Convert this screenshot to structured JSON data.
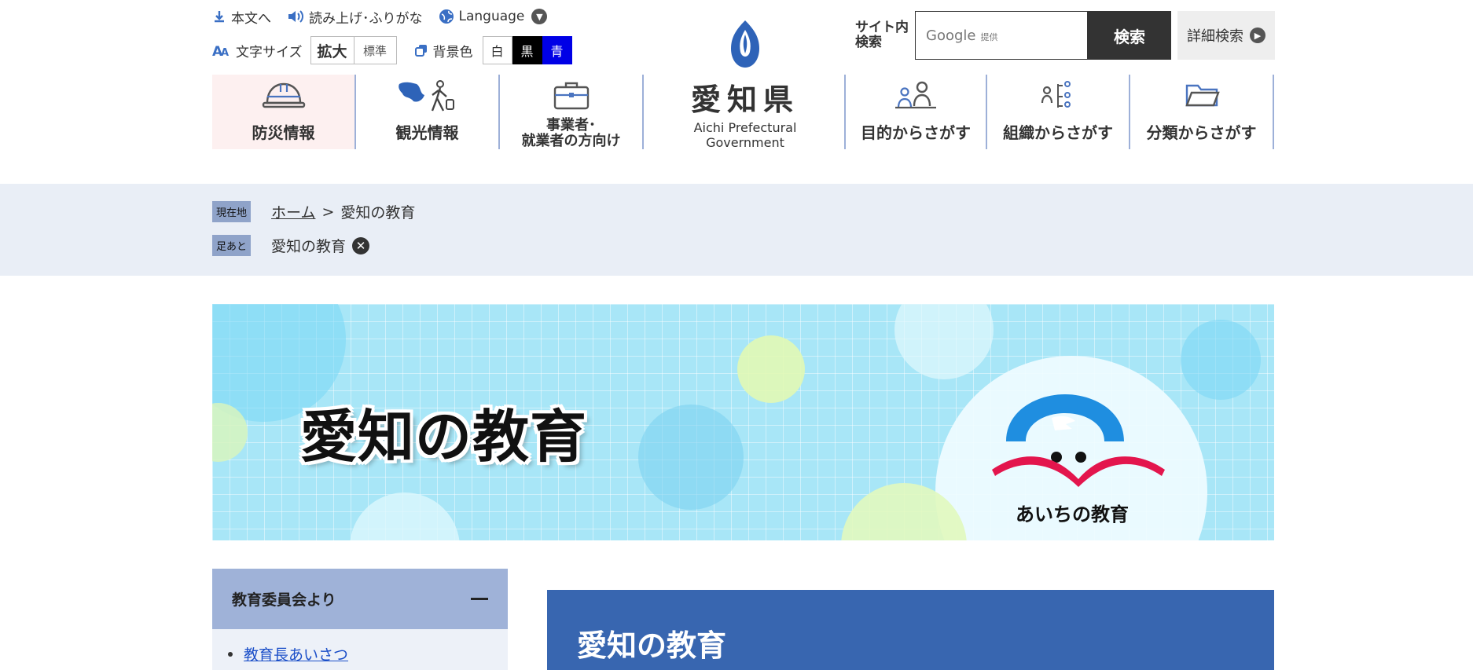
{
  "header": {
    "skip_link": "本文へ",
    "read_aloud": "読み上げ･ふりがな",
    "language": "Language",
    "text_size_label": "文字サイズ",
    "text_size_large": "拡大",
    "text_size_standard": "標準",
    "bg_color_label": "背景色",
    "bg_white": "白",
    "bg_black": "黒",
    "bg_blue": "青",
    "logo_name": "愛知県",
    "logo_en": "Aichi Prefectural Government",
    "search_label": "サイト内 検索",
    "search_brand": "Google",
    "search_provider": "提供",
    "search_button": "検索",
    "advanced_search": "詳細検索"
  },
  "nav": {
    "disaster": "防災情報",
    "tourism": "観光情報",
    "business_line1": "事業者･",
    "business_line2": "就業者の方向け",
    "purpose": "目的からさがす",
    "organization": "組織からさがす",
    "category": "分類からさがす"
  },
  "breadcrumb": {
    "current_tag": "現在地",
    "home": "ホーム",
    "separator": ">",
    "current": "愛知の教育",
    "history_tag": "足あと",
    "history_item": "愛知の教育"
  },
  "banner": {
    "title": "愛知の教育",
    "mascot_text": "あいちの教育"
  },
  "sidebar": {
    "section_title": "教育委員会より",
    "items": [
      {
        "label": "教育長あいさつ"
      }
    ]
  },
  "main": {
    "heading": "愛知の教育"
  },
  "colors": {
    "nav_border": "#9db0d8",
    "crumb_band": "#e9eef6",
    "sidebar_head": "#9fb2d8",
    "heading_bg": "#3866b0",
    "link": "#1a4ec8"
  }
}
